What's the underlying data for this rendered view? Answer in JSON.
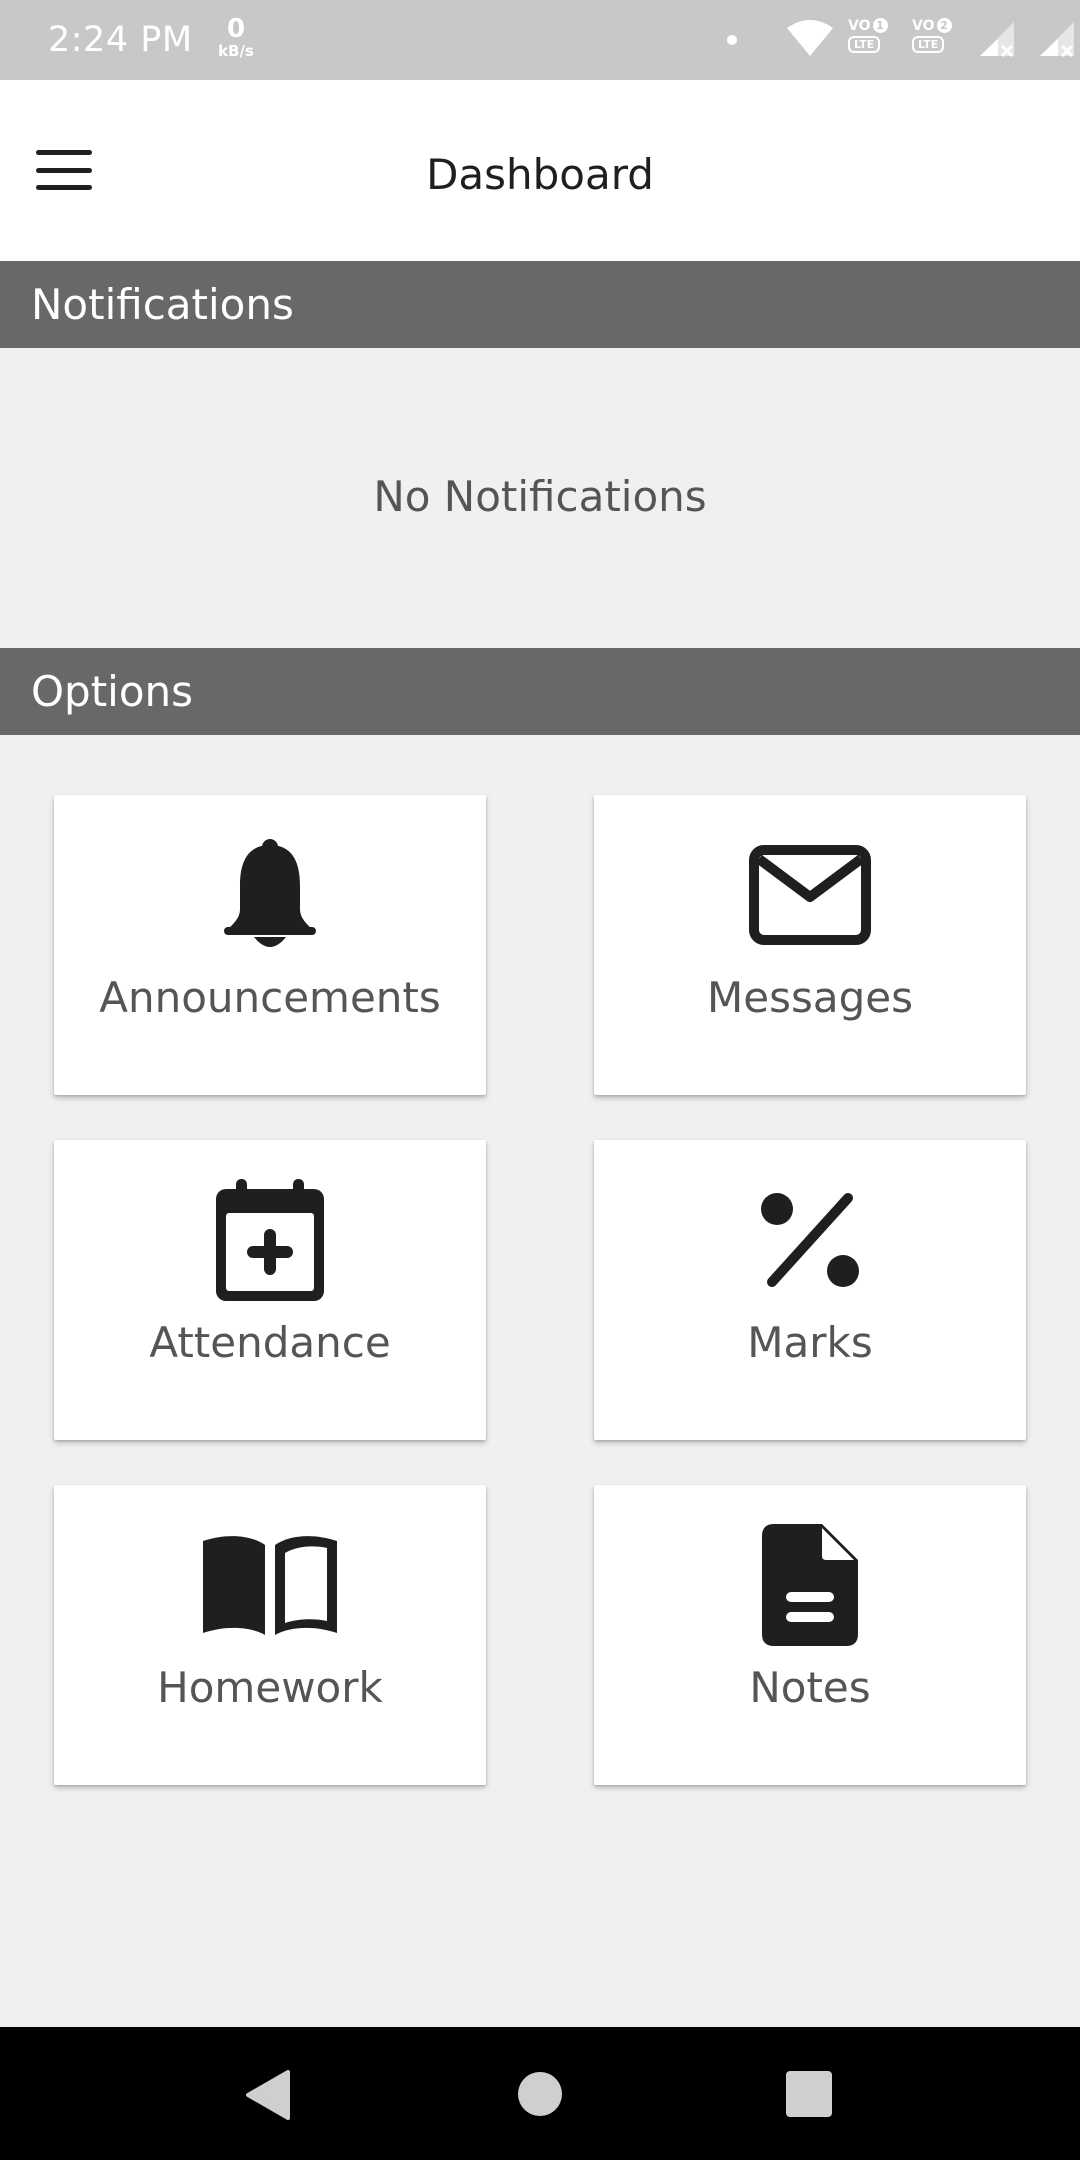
{
  "status_bar": {
    "time": "2:24 PM",
    "net_speed_value": "0",
    "net_speed_unit": "kB/s",
    "vo1_label": "VO",
    "vo1_badge": "1",
    "vo1_lte": "LTE",
    "vo2_label": "VO",
    "vo2_badge": "2",
    "vo2_lte": "LTE",
    "icons": [
      "dot-icon",
      "wifi-icon",
      "volte-1-icon",
      "volte-2-icon",
      "signal-1-icon",
      "signal-2-icon",
      "battery-icon"
    ]
  },
  "app_bar": {
    "title": "Dashboard",
    "menu_icon": "hamburger-menu-icon"
  },
  "notifications": {
    "header": "Notifications",
    "empty_text": "No Notifications"
  },
  "options": {
    "header": "Options",
    "tiles": [
      {
        "label": "Announcements",
        "icon": "bell-icon"
      },
      {
        "label": "Messages",
        "icon": "envelope-icon"
      },
      {
        "label": "Attendance",
        "icon": "calendar-plus-icon"
      },
      {
        "label": "Marks",
        "icon": "percent-icon"
      },
      {
        "label": "Homework",
        "icon": "book-open-icon"
      },
      {
        "label": "Notes",
        "icon": "file-text-icon"
      }
    ]
  },
  "nav_bar": {
    "icons": [
      "back-icon",
      "home-icon",
      "recents-icon"
    ]
  },
  "colors": {
    "status_bar": "#c8c8c8",
    "section_header": "#686868",
    "background": "#f0f0f0",
    "icon": "#1f1f1f",
    "label_text": "#555555"
  }
}
